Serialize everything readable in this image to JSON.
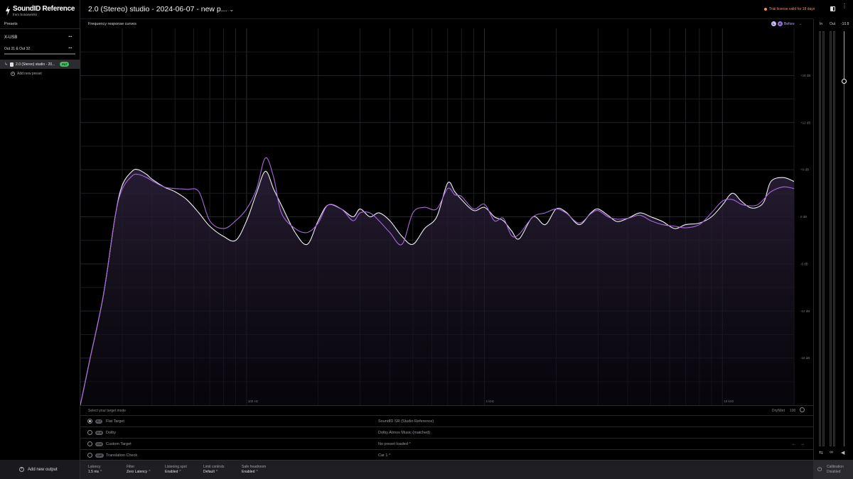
{
  "app": {
    "logo_title": "SoundID Reference",
    "logo_sub": "from Sonarworks",
    "title": "2.0 (Stereo) studio - 2024-06-07 - new p...",
    "trial": "Trial license valid for 18 days"
  },
  "sidebar": {
    "presets_label": "Presets",
    "device": "X-USB",
    "output": "Out 31 & Out 32",
    "preset_name": "2.0 (Stereo) studio - 20...",
    "preset_badge": "FLT",
    "add_preset": "Add new preset",
    "add_output": "Add new output"
  },
  "chart_header": {
    "label": "Frequency response curves",
    "legend_l": "L",
    "legend_r": "R",
    "legend_text": "Before"
  },
  "chart_data": {
    "type": "line",
    "xscale": "log",
    "xlim": [
      20,
      20000
    ],
    "ylim": [
      -24,
      24
    ],
    "x_ticks": [
      "100 Hz",
      "1 kHz",
      "10 kHz"
    ],
    "x_tick_values": [
      100,
      1000,
      10000
    ],
    "y_ticks": [
      "+18 dB",
      "+12 dB",
      "+6 dB",
      "0 dB",
      "-6 dB",
      "-12 dB",
      "-18 dB"
    ],
    "y_tick_values": [
      18,
      12,
      6,
      0,
      -6,
      -12,
      -18
    ],
    "grid": true,
    "series": [
      {
        "color": "#f0f0f5",
        "x": [
          20,
          22,
          25,
          28,
          30,
          33,
          35,
          38,
          40,
          45,
          50,
          56,
          63,
          70,
          80,
          90,
          100,
          110,
          120,
          130,
          140,
          160,
          180,
          200,
          220,
          250,
          280,
          300,
          330,
          360,
          400,
          450,
          500,
          560,
          630,
          700,
          750,
          800,
          900,
          1000,
          1100,
          1200,
          1300,
          1400,
          1600,
          1800,
          2000,
          2200,
          2500,
          2800,
          3000,
          3300,
          3600,
          4000,
          4500,
          5000,
          5600,
          6300,
          7000,
          8000,
          9000,
          10000,
          11000,
          12000,
          13000,
          14000,
          15000,
          16000,
          18000,
          20000
        ],
        "y": [
          -24,
          -18,
          -10,
          0,
          4,
          5.8,
          6,
          5.4,
          4.8,
          3.8,
          3.2,
          2.2,
          0.5,
          -1.2,
          -2.5,
          -3,
          -0.5,
          3,
          5.8,
          3.5,
          1.5,
          -2,
          -3.5,
          -0.5,
          1.5,
          1,
          0,
          1,
          0,
          0.5,
          -0.5,
          -2.5,
          -3.5,
          -1.5,
          0,
          4.3,
          3.2,
          2.2,
          0.8,
          1.2,
          0,
          -0.5,
          -1.8,
          -2.8,
          0,
          -1,
          1,
          0.6,
          -1,
          0.5,
          1,
          0.2,
          -0.6,
          -0.2,
          0.5,
          0,
          -0.6,
          -1.5,
          -1,
          -0.8,
          0,
          1.5,
          3,
          2,
          1.2,
          1.2,
          2,
          4.5,
          5,
          4.5
        ]
      },
      {
        "color": "#a868dc",
        "x": [
          20,
          22,
          25,
          28,
          30,
          33,
          35,
          38,
          40,
          45,
          50,
          56,
          63,
          70,
          80,
          90,
          100,
          110,
          120,
          130,
          140,
          160,
          180,
          200,
          220,
          250,
          280,
          300,
          330,
          360,
          400,
          450,
          500,
          560,
          630,
          700,
          750,
          800,
          900,
          1000,
          1100,
          1200,
          1300,
          1400,
          1600,
          1800,
          2000,
          2200,
          2500,
          2800,
          3000,
          3300,
          3600,
          4000,
          4500,
          5000,
          5600,
          6300,
          7000,
          8000,
          9000,
          10000,
          11000,
          12000,
          13000,
          14000,
          15000,
          16000,
          18000,
          20000
        ],
        "y": [
          -24,
          -18,
          -10,
          0,
          3.5,
          5.2,
          5.4,
          5,
          4.6,
          3.8,
          3.6,
          3.5,
          3.2,
          -0.5,
          -1.5,
          -0.5,
          1,
          3.5,
          7.5,
          5,
          0.5,
          -1.5,
          -2,
          -0.8,
          1.5,
          1,
          -0.5,
          0.5,
          0.5,
          -0.5,
          -2,
          -3.5,
          0.5,
          1.2,
          1,
          3.6,
          2.8,
          2.6,
          1,
          1.6,
          -0.5,
          -0.2,
          -2.4,
          -2.2,
          0,
          0.5,
          1,
          0.5,
          -0.8,
          0.4,
          0.8,
          0,
          -0.3,
          -0.2,
          0.2,
          -0.5,
          -1,
          -1.2,
          -1.4,
          -1,
          0.5,
          2,
          2.2,
          1.6,
          1.4,
          1.5,
          2.3,
          3.2,
          3.8,
          3.6
        ]
      }
    ]
  },
  "target": {
    "mode_label": "Select your target mode",
    "drywet_label": "Dry/Wet",
    "drywet_value": "100",
    "rows": [
      {
        "badge": "FLT",
        "name": "Flat Target",
        "value": "SoundID SR (Studio Reference)"
      },
      {
        "badge": "DLB",
        "name": "Dolby",
        "value": "Dolby Atmos Music (matched)"
      },
      {
        "badge": "CUS",
        "name": "Custom Target",
        "value": "No preset loaded"
      },
      {
        "badge": "CAR",
        "name": "Translation Check",
        "value": "Car 1"
      }
    ]
  },
  "footer": {
    "latency_label": "Latency",
    "latency_value": "1.5 ms",
    "filter_label": "Filter",
    "filter_value": "Zero Latency",
    "spot_label": "Listening spot",
    "spot_value": "Enabled",
    "limit_label": "Limit controls",
    "limit_value": "Default",
    "headroom_label": "Safe headroom",
    "headroom_value": "Enabled",
    "calib_label": "Calibration",
    "calib_value": "Disabled"
  },
  "meters": {
    "in_label": "In",
    "out_label": "Out",
    "gain_value": "-10.8",
    "fader_level": 0.88
  }
}
